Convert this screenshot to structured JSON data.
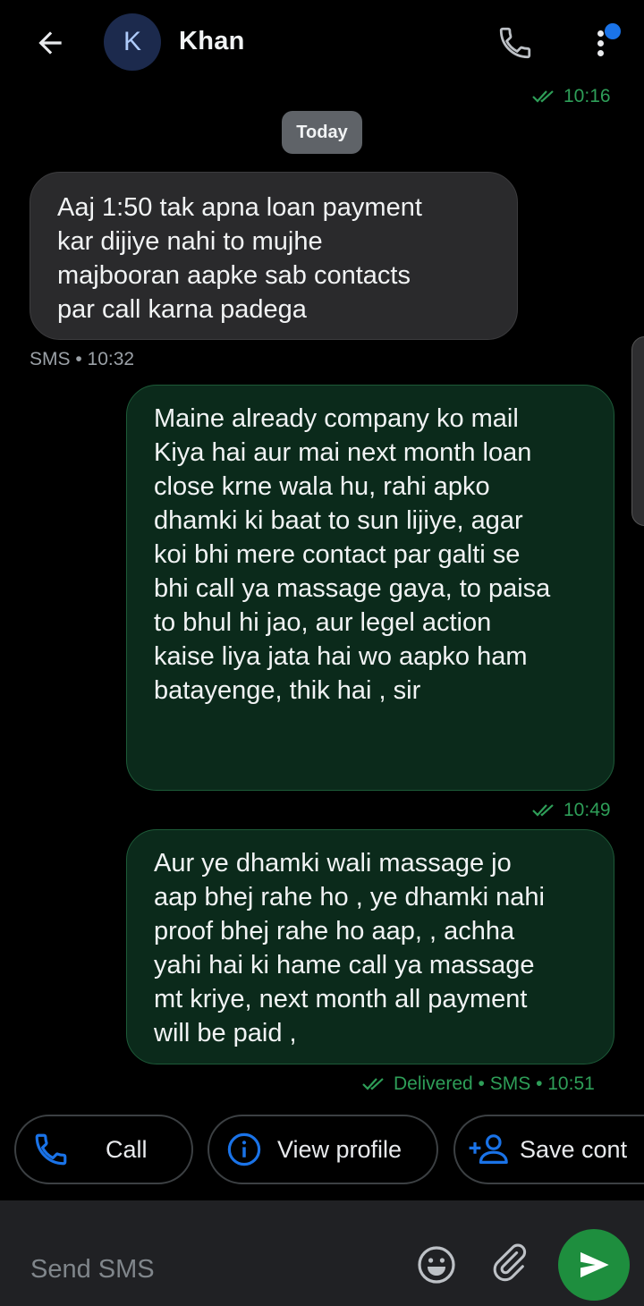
{
  "header": {
    "contact_name": "Khan",
    "avatar_letter": "K",
    "accent_color": "#1a73e8"
  },
  "conversation": {
    "top_timestamp": "10:16",
    "date_divider": "Today",
    "messages": [
      {
        "direction": "incoming",
        "text": "Aaj 1:50 tak apna loan payment\nkar dijiye nahi to mujhe\nmajbooran aapke sab contacts\npar call karna padega",
        "meta": "SMS • 10:32"
      },
      {
        "direction": "outgoing",
        "text": "Maine already company ko mail\nKiya hai aur mai next month loan\nclose krne wala hu, rahi apko\ndhamki ki baat to sun lijiye, agar\nkoi bhi mere  contact par galti se\nbhi call ya massage gaya, to paisa\nto bhul hi jao, aur legel action\nkaise liya jata hai wo aapko ham\nbatayenge, thik hai , sir",
        "meta": "10:49"
      },
      {
        "direction": "outgoing",
        "text": "Aur ye dhamki wali massage jo\naap bhej rahe ho , ye dhamki nahi\nproof bhej rahe ho aap, , achha\nyahi hai ki hame call ya massage\nmt kriye, next month all payment\nwill be paid ,",
        "meta": "Delivered • SMS • 10:51"
      }
    ]
  },
  "actions": {
    "call_label": "Call",
    "view_profile_label": "View profile",
    "save_contact_label": "Save cont"
  },
  "compose": {
    "placeholder": "Send SMS"
  },
  "colors": {
    "incoming_bubble": "#2a2a2c",
    "outgoing_bubble": "#0b2a1b",
    "send_button": "#1e8e3e",
    "status_green": "#2e9e58"
  }
}
